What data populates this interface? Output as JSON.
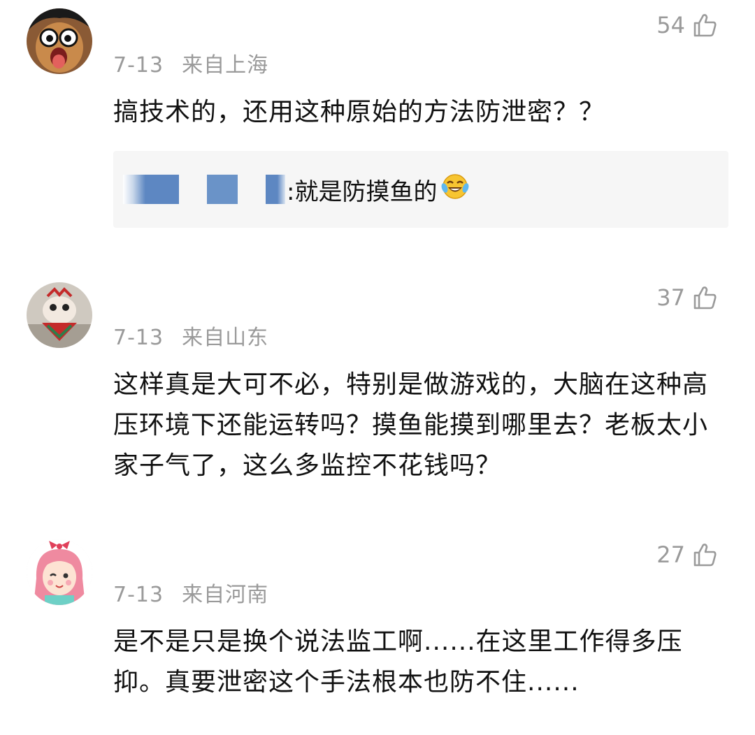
{
  "comments": [
    {
      "date": "7-13",
      "location": "来自上海",
      "likes": "54",
      "text": "搞技术的，还用这种原始的方法防泄密？？",
      "reply": {
        "text": ":就是防摸鱼的",
        "emoji": "laughing-tears-emoji"
      },
      "avatar": "cartoon-face-avatar"
    },
    {
      "date": "7-13",
      "location": "来自山东",
      "likes": "37",
      "text": "这样真是大可不必，特别是做游戏的，大脑在这种高压环境下还能运转吗？摸鱼能摸到哪里去？老板太小家子气了，这么多监控不花钱吗？",
      "avatar": "lion-dance-avatar"
    },
    {
      "date": "7-13",
      "location": "来自河南",
      "likes": "27",
      "text": "是不是只是换个说法监工啊......在这里工作得多压抑。真要泄密这个手法根本也防不住......",
      "avatar": "pink-hair-girl-avatar"
    }
  ],
  "colors": {
    "meta": "#9a9a9a",
    "text": "#111111",
    "reply_bg": "#f6f6f6"
  },
  "icons": {
    "like": "thumbs-up-outline-icon"
  }
}
